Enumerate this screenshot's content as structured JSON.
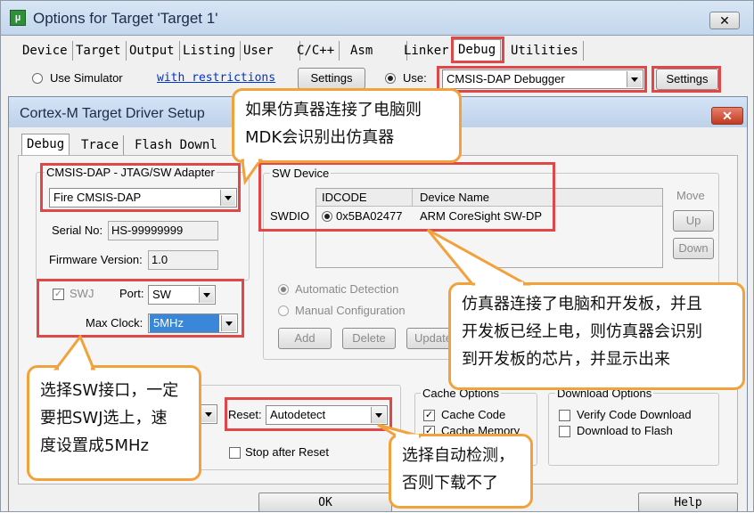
{
  "outer": {
    "title": "Options for Target 'Target 1'",
    "tabs": [
      "Device",
      "Target",
      "Output",
      "Listing",
      "User",
      "C/C++",
      "Asm",
      "Linker",
      "Debug",
      "Utilities"
    ],
    "active_tab": "Debug",
    "use_simulator": "Use Simulator",
    "with_restrictions": "with restrictions",
    "settings_left": "Settings",
    "use_label": "Use:",
    "debugger": "CMSIS-DAP Debugger",
    "settings_right": "Settings",
    "ok": "OK",
    "help": "Help"
  },
  "inner": {
    "title": "Cortex-M Target Driver Setup",
    "tabs": [
      "Debug",
      "Trace",
      "Flash Downl"
    ],
    "adapter": {
      "legend": "CMSIS-DAP - JTAG/SW Adapter",
      "selected": "Fire CMSIS-DAP",
      "serial_label": "Serial No:",
      "serial_value": "HS-99999999",
      "firmware_label": "Firmware Version:",
      "firmware_value": "1.0",
      "swj_label": "SWJ",
      "port_label": "Port:",
      "port_value": "SW",
      "maxclock_label": "Max Clock:",
      "maxclock_value": "5MHz"
    },
    "sw_device": {
      "legend": "SW Device",
      "col_idcode": "IDCODE",
      "col_name": "Device Name",
      "row_label": "SWDIO",
      "idcode": "0x5BA02477",
      "device_name": "ARM CoreSight SW-DP",
      "move": "Move",
      "up": "Up",
      "down": "Down",
      "auto_detect": "Automatic Detection",
      "manual_config": "Manual Configuration",
      "add": "Add",
      "delete": "Delete",
      "update": "Update"
    },
    "reset_label": "Reset:",
    "reset_value": "Autodetect",
    "stop_after_reset": "Stop after Reset",
    "cache_options": {
      "legend": "Cache Options",
      "cache_code": "Cache Code",
      "cache_memory": "Cache Memory"
    },
    "download_options": {
      "legend": "Download Options",
      "verify": "Verify Code Download",
      "download_flash": "Download to Flash"
    }
  },
  "callouts": {
    "top": [
      "如果仿真器连接了电脑则",
      "MDK会识别出仿真器"
    ],
    "right": [
      "仿真器连接了电脑和开发板，并且",
      "开发板已经上电，则仿真器会识别",
      "到开发板的芯片，并显示出来"
    ],
    "left": [
      "选择SW接口，一定",
      "要把SWJ选上，速",
      "度设置成5MHz"
    ],
    "bottom": [
      "选择自动检测，",
      "否则下载不了"
    ]
  },
  "colors": {
    "highlight": "#e04848",
    "callout_border": "#f2a23c",
    "selection": "#3a86d8"
  }
}
